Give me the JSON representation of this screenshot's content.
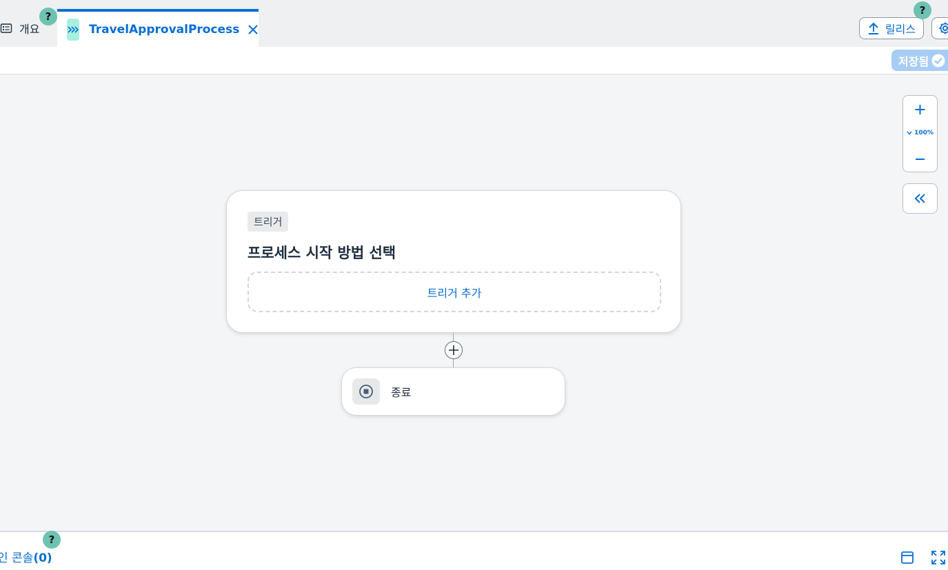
{
  "tabs": {
    "overview_label": "개요",
    "active_label": "TravelApprovalProcess",
    "active_icon": "process-icon"
  },
  "help": {
    "label": "?"
  },
  "header": {
    "release_label": "릴리스",
    "saved_label": "저장됨"
  },
  "zoom": {
    "level": "100%"
  },
  "trigger": {
    "tag": "트리거",
    "title": "프로세스 시작 방법 선택",
    "add_label": "트리거 추가"
  },
  "end_node": {
    "label": "종료"
  },
  "console": {
    "label": "인 콘솔",
    "count": "(0)"
  },
  "colors": {
    "accent": "#0a6ed1",
    "help": "#6fc1b1",
    "tab_icon_bg": "#a7f0e0",
    "saved_bg": "#a8cdf5"
  }
}
